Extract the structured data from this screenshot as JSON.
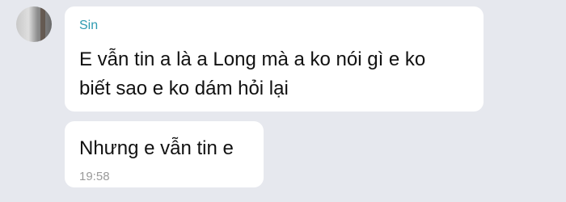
{
  "chat": {
    "sender_name": "Sin",
    "messages": [
      {
        "line1": "E vẫn tin a là a Long mà a ko nói gì e ko",
        "line2": "biết sao e ko dám hỏi lại"
      },
      {
        "text": "Nhưng e vẫn tin e",
        "time": "19:58"
      }
    ]
  }
}
